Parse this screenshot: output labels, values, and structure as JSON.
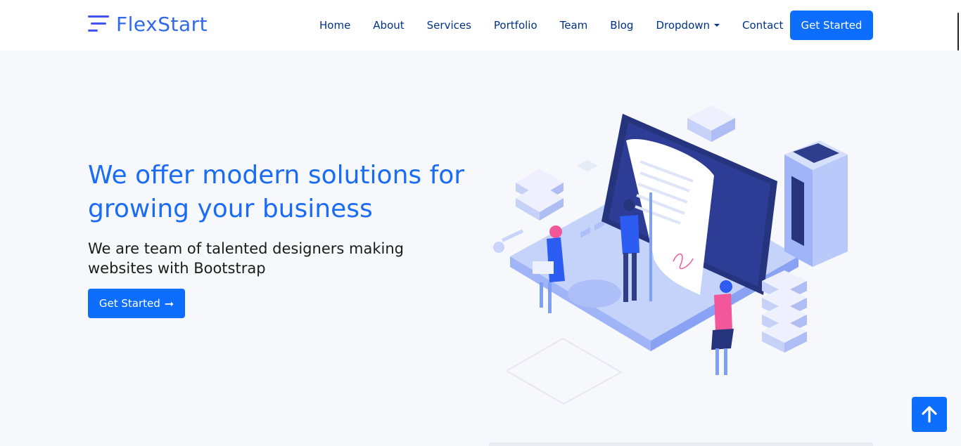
{
  "brand": {
    "name": "FlexStart",
    "icon": "logo-mark-icon"
  },
  "nav": {
    "items": [
      "Home",
      "About",
      "Services",
      "Portfolio",
      "Team",
      "Blog",
      "Dropdown",
      "Contact"
    ],
    "cta_label": "Get Started"
  },
  "hero": {
    "title": "We offer modern solutions for growing your business",
    "subtitle": "We are team of talented designers making websites with Bootstrap",
    "cta_label": "Get Started",
    "cta_icon": "arrow-right-icon",
    "illustration": "isometric-laptop-illustration"
  },
  "back_to_top": {
    "icon": "arrow-up-icon"
  },
  "colors": {
    "accent": "#0d6efd",
    "title": "#1a6cf6",
    "nav": "#013289",
    "background": "#f6f8fb"
  }
}
